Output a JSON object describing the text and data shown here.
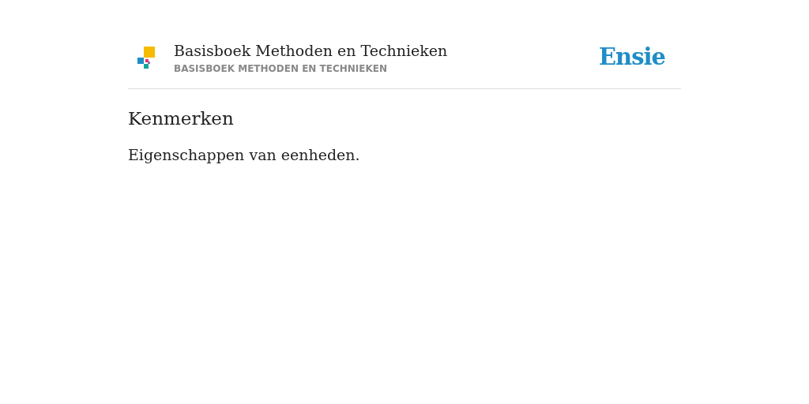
{
  "header": {
    "title": "Basisboek Methoden en Technieken",
    "subtitle": "BASISBOEK METHODEN EN TECHNIEKEN",
    "logo": "Ensie"
  },
  "article": {
    "heading": "Kenmerken",
    "body": "Eigenschappen van eenheden."
  }
}
